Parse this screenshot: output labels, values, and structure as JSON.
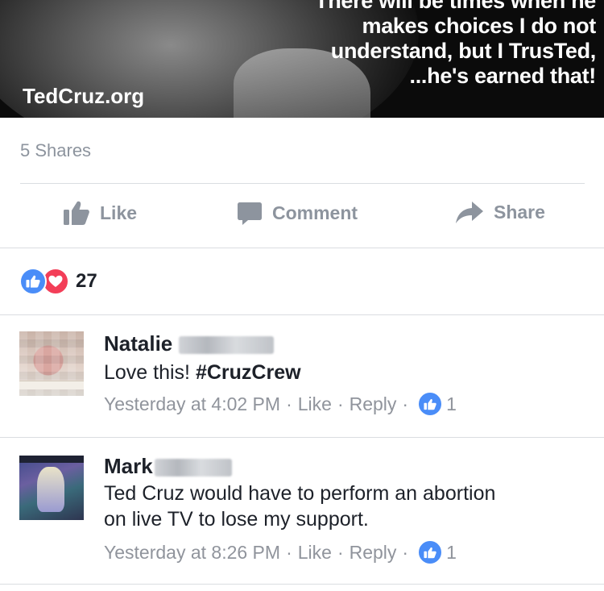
{
  "hero": {
    "quote_lines": [
      "There will be times when he",
      "makes choices I do not",
      "understand, but I TrusTed,",
      "...he's earned that!"
    ],
    "site": "TedCruz.org"
  },
  "post": {
    "shares": "5 Shares",
    "actions": {
      "like": "Like",
      "comment": "Comment",
      "share": "Share"
    },
    "reaction_count": "27"
  },
  "comments": [
    {
      "name": "Natalie",
      "text_plain": "Love this! ",
      "hashtag": "#CruzCrew",
      "time": "Yesterday at 4:02 PM",
      "like": "Like",
      "reply": "Reply",
      "likes": "1"
    },
    {
      "name": "Mark",
      "text_line1": "Ted Cruz would have to perform an abortion",
      "text_line2": "on live TV to lose my support.",
      "time": "Yesterday at 8:26 PM",
      "like": "Like",
      "reply": "Reply",
      "likes": "1"
    }
  ],
  "colors": {
    "like_blue": "#4a8df8",
    "love_red": "#f33e58",
    "meta_gray": "#90949c"
  }
}
